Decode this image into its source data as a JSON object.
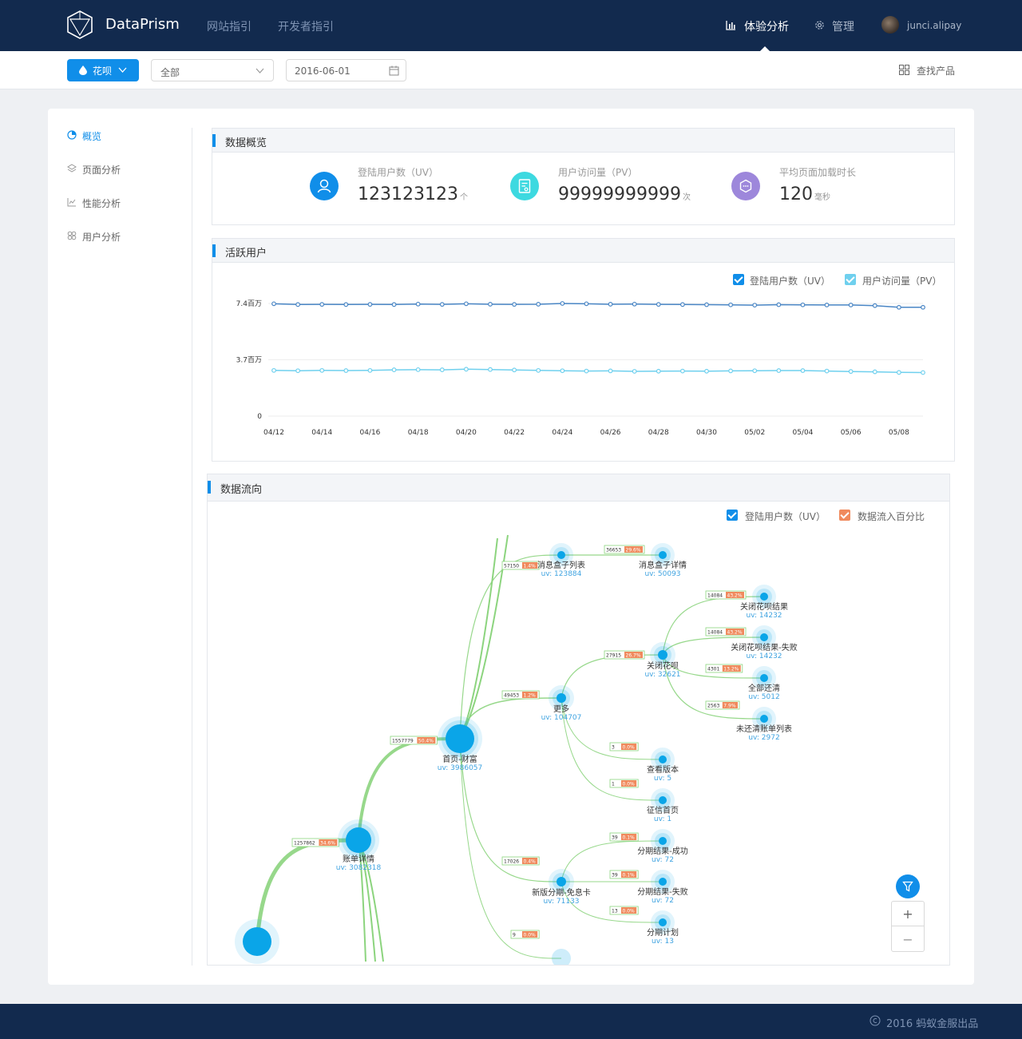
{
  "header": {
    "brand": "DataPrism",
    "nav_site_guide": "网站指引",
    "nav_dev_guide": "开发者指引",
    "nav_experience": "体验分析",
    "nav_manage": "管理",
    "username": "junci.alipay"
  },
  "toolbar": {
    "product_button": "花呗",
    "scope_select": "全部",
    "date_value": "2016-06-01",
    "find_product": "查找产品"
  },
  "sidebar": {
    "items": [
      {
        "label": "概览",
        "icon": "pie-chart-icon",
        "active": true
      },
      {
        "label": "页面分析",
        "icon": "layers-icon"
      },
      {
        "label": "性能分析",
        "icon": "line-chart-icon"
      },
      {
        "label": "用户分析",
        "icon": "users-icon"
      }
    ]
  },
  "overview": {
    "title": "数据概览",
    "kpis": [
      {
        "label": "登陆用户数（UV）",
        "value": "123123123",
        "unit": "个",
        "color": "#108ee9",
        "icon": "user-icon"
      },
      {
        "label": "用户访问量（PV）",
        "value": "99999999999",
        "unit": "次",
        "color": "#3dd9e0",
        "icon": "document-icon"
      },
      {
        "label": "平均页面加载时长",
        "value": "120",
        "unit": "毫秒",
        "color": "#9d87db",
        "icon": "hexagon-icon"
      }
    ]
  },
  "active_users": {
    "title": "活跃用户",
    "legend_uv": "登陆用户数（UV）",
    "legend_pv": "用户访问量（PV）",
    "colors": {
      "uv": "#4a86c5",
      "pv": "#6fd0ee"
    }
  },
  "chart_data": {
    "type": "line",
    "x": [
      "04/12",
      "04/13",
      "04/14",
      "04/15",
      "04/16",
      "04/17",
      "04/18",
      "04/19",
      "04/20",
      "04/21",
      "04/22",
      "04/23",
      "04/24",
      "04/25",
      "04/26",
      "04/27",
      "04/28",
      "04/29",
      "04/30",
      "05/01",
      "05/02",
      "05/03",
      "05/04",
      "05/05",
      "05/06",
      "05/07",
      "05/08",
      "05/09"
    ],
    "xticks": [
      "04/12",
      "04/14",
      "04/16",
      "04/18",
      "04/20",
      "04/22",
      "04/24",
      "04/26",
      "04/28",
      "04/30",
      "05/02",
      "05/04",
      "05/06",
      "05/08"
    ],
    "yticks": [
      {
        "value": 0,
        "label": "0"
      },
      {
        "value": 3.7,
        "label": "3.7百万"
      },
      {
        "value": 7.4,
        "label": "7.4百万"
      }
    ],
    "ylim": [
      0,
      7.4
    ],
    "series": [
      {
        "name": "登陆用户数（UV）",
        "values": [
          7.38,
          7.33,
          7.34,
          7.33,
          7.34,
          7.33,
          7.36,
          7.34,
          7.38,
          7.35,
          7.34,
          7.35,
          7.4,
          7.38,
          7.35,
          7.36,
          7.34,
          7.33,
          7.32,
          7.31,
          7.29,
          7.32,
          7.31,
          7.3,
          7.3,
          7.26,
          7.15,
          7.15
        ]
      },
      {
        "name": "用户访问量（PV）",
        "values": [
          3.0,
          2.98,
          3.0,
          2.99,
          3.0,
          3.04,
          3.05,
          3.04,
          3.08,
          3.06,
          3.03,
          3.0,
          2.98,
          2.96,
          2.97,
          2.94,
          2.95,
          2.96,
          2.95,
          2.97,
          2.98,
          2.99,
          2.99,
          2.96,
          2.93,
          2.91,
          2.87,
          2.86
        ]
      }
    ],
    "grid": true
  },
  "flow": {
    "title": "数据流向",
    "legend_uv": "登陆用户数（UV）",
    "legend_pct": "数据流入百分比",
    "colors": {
      "node": "#0aa5e8",
      "link": "#8cd47e",
      "pct": "#f08a5d"
    },
    "nodes": [
      {
        "name": "消息盒子列表",
        "uv": "uv: 123884"
      },
      {
        "name": "消息盒子详情",
        "uv": "uv: 50093"
      },
      {
        "name": "关闭花呗结果",
        "uv": "uv: 14232"
      },
      {
        "name": "关闭花呗结果-失败",
        "uv": "uv: 14232"
      },
      {
        "name": "关闭花呗",
        "uv": "uv: 32621"
      },
      {
        "name": "全部还清",
        "uv": "uv: 5012"
      },
      {
        "name": "更多",
        "uv": "uv: 104707"
      },
      {
        "name": "未还清账单列表",
        "uv": "uv: 2972"
      },
      {
        "name": "首页-财富",
        "uv": "uv: 3986057"
      },
      {
        "name": "查看版本",
        "uv": "uv: 5"
      },
      {
        "name": "征信首页",
        "uv": "uv: 1"
      },
      {
        "name": "账单详情",
        "uv": "uv: 3082318"
      },
      {
        "name": "分期结果-成功",
        "uv": "uv: 72"
      },
      {
        "name": "新版分期-免息卡",
        "uv": "uv: 71133"
      },
      {
        "name": "分期结果-失败",
        "uv": "uv: 72"
      },
      {
        "name": "分期计划",
        "uv": "uv: 13"
      }
    ],
    "links": [
      {
        "value": "57150",
        "pct": "1.4%"
      },
      {
        "value": "36653",
        "pct": "29.6%"
      },
      {
        "value": "14084",
        "pct": "43.2%"
      },
      {
        "value": "14084",
        "pct": "43.2%"
      },
      {
        "value": "27915",
        "pct": "26.7%"
      },
      {
        "value": "4301",
        "pct": "13.2%"
      },
      {
        "value": "49453",
        "pct": "1.2%"
      },
      {
        "value": "2563",
        "pct": "7.9%"
      },
      {
        "value": "1557779",
        "pct": "50.4%"
      },
      {
        "value": "3",
        "pct": "0.0%"
      },
      {
        "value": "1",
        "pct": "0.0%"
      },
      {
        "value": "1257862",
        "pct": "34.6%"
      },
      {
        "value": "39",
        "pct": "0.1%"
      },
      {
        "value": "17026",
        "pct": "0.4%"
      },
      {
        "value": "39",
        "pct": "0.1%"
      },
      {
        "value": "13",
        "pct": "0.0%"
      },
      {
        "value": "9",
        "pct": "0.0%"
      }
    ],
    "zoom_in": "+",
    "zoom_out": "−"
  },
  "footer": {
    "copyright": "2016 蚂蚁金服出品"
  }
}
